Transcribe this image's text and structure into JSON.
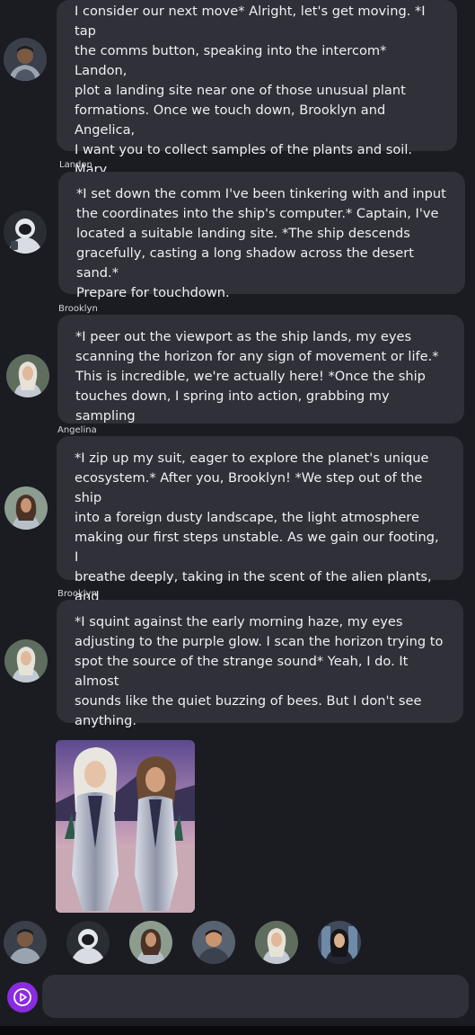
{
  "messages": [
    {
      "speaker": "",
      "text": "I consider our next move* Alright, let's get moving. *I tap\nthe comms button, speaking into the intercom* Landon,\nplot a landing site near one of those unusual plant\nformations. Once we touch down, Brooklyn and Angelica,\nI want you to collect samples of the plants and soil. Mary,\nyou're with me. We'll scout ahead and try to locate the\nsource of those signals."
    },
    {
      "speaker": "Landon",
      "text": "*I set down the comm I've been tinkering with and input\nthe coordinates into the ship's computer.* Captain, I've\nlocated a suitable landing site. *The ship descends\ngracefully, casting a long shadow across the desert sand.*\nPrepare for touchdown."
    },
    {
      "speaker": "Brooklyn",
      "text": "*I peer out the viewport as the ship lands, my eyes\nscanning the horizon for any sign of movement or life.*\nThis is incredible, we're actually here! *Once the ship\ntouches down, I spring into action, grabbing my sampling\ngear and rushing toward the exit.* Let's move, Angelica!"
    },
    {
      "speaker": "Angelina",
      "text": "*I zip up my suit, eager to explore the planet's unique\necosystem.* After you, Brooklyn! *We step out of the ship\ninto a foreign dusty landscape, the light atmosphere\nmaking our first steps unstable. As we gain our footing, I\nbreathe deeply, taking in the scent of the alien plants, and\nnotice a faint hum.* Do you hear that?"
    },
    {
      "speaker": "Brooklyn",
      "text": "*I squint against the early morning haze, my eyes\nadjusting to the purple glow. I scan the horizon trying to\nspot the source of the strange sound* Yeah, I do. It almost\nsounds like the quiet buzzing of bees. But I don't see\nanything."
    }
  ],
  "characters": [
    "captain",
    "landon",
    "brooklyn",
    "tech-crew",
    "angelina",
    "mary"
  ],
  "icons": {
    "send": "play-circle-icon"
  },
  "colors": {
    "background": "#1b1c22",
    "bubble": "#2f3038",
    "accent": "#8a2be2"
  }
}
